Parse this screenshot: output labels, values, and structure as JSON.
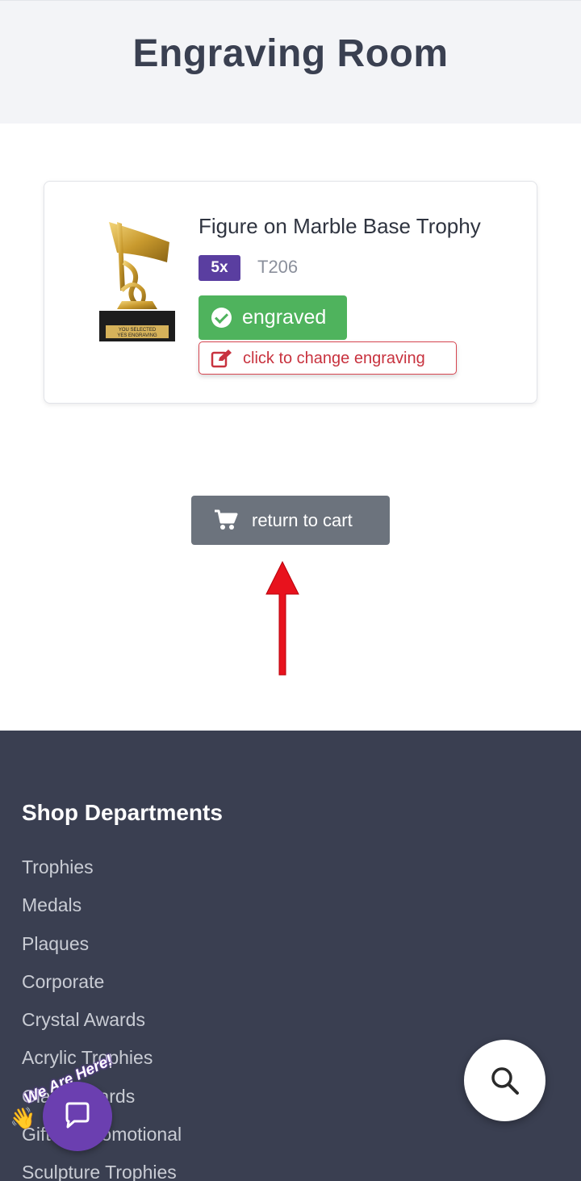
{
  "header": {
    "title": "Engraving Room"
  },
  "item": {
    "name": "Figure on Marble Base Trophy",
    "quantity": "5x",
    "sku": "T206",
    "status": "engraved",
    "change_label": "click to change engraving",
    "plate_line1": "YOU SELECTED",
    "plate_line2": "YES ENGRAVING"
  },
  "actions": {
    "return_label": "return to cart"
  },
  "footer": {
    "heading": "Shop Departments",
    "departments": [
      "Trophies",
      "Medals",
      "Plaques",
      "Corporate",
      "Crystal Awards",
      "Acrylic Trophies",
      "Glass Awards",
      "Gifts & Promotional",
      "Sculpture Trophies"
    ]
  },
  "chat": {
    "badge": "We Are Here!"
  },
  "colors": {
    "header_bg": "#f3f4f7",
    "qty_badge": "#5a3ea0",
    "engraved_green": "#4fb35d",
    "change_red": "#c8323e",
    "button_gray": "#6c737d",
    "arrow_red": "#e8121d",
    "footer_bg": "#3a3f51",
    "chat_purple": "#6b3fb0"
  },
  "icons": {
    "status": "check-circle-icon",
    "change": "edit-icon",
    "cart": "cart-icon",
    "search": "search-icon",
    "chat": "chat-icon"
  }
}
